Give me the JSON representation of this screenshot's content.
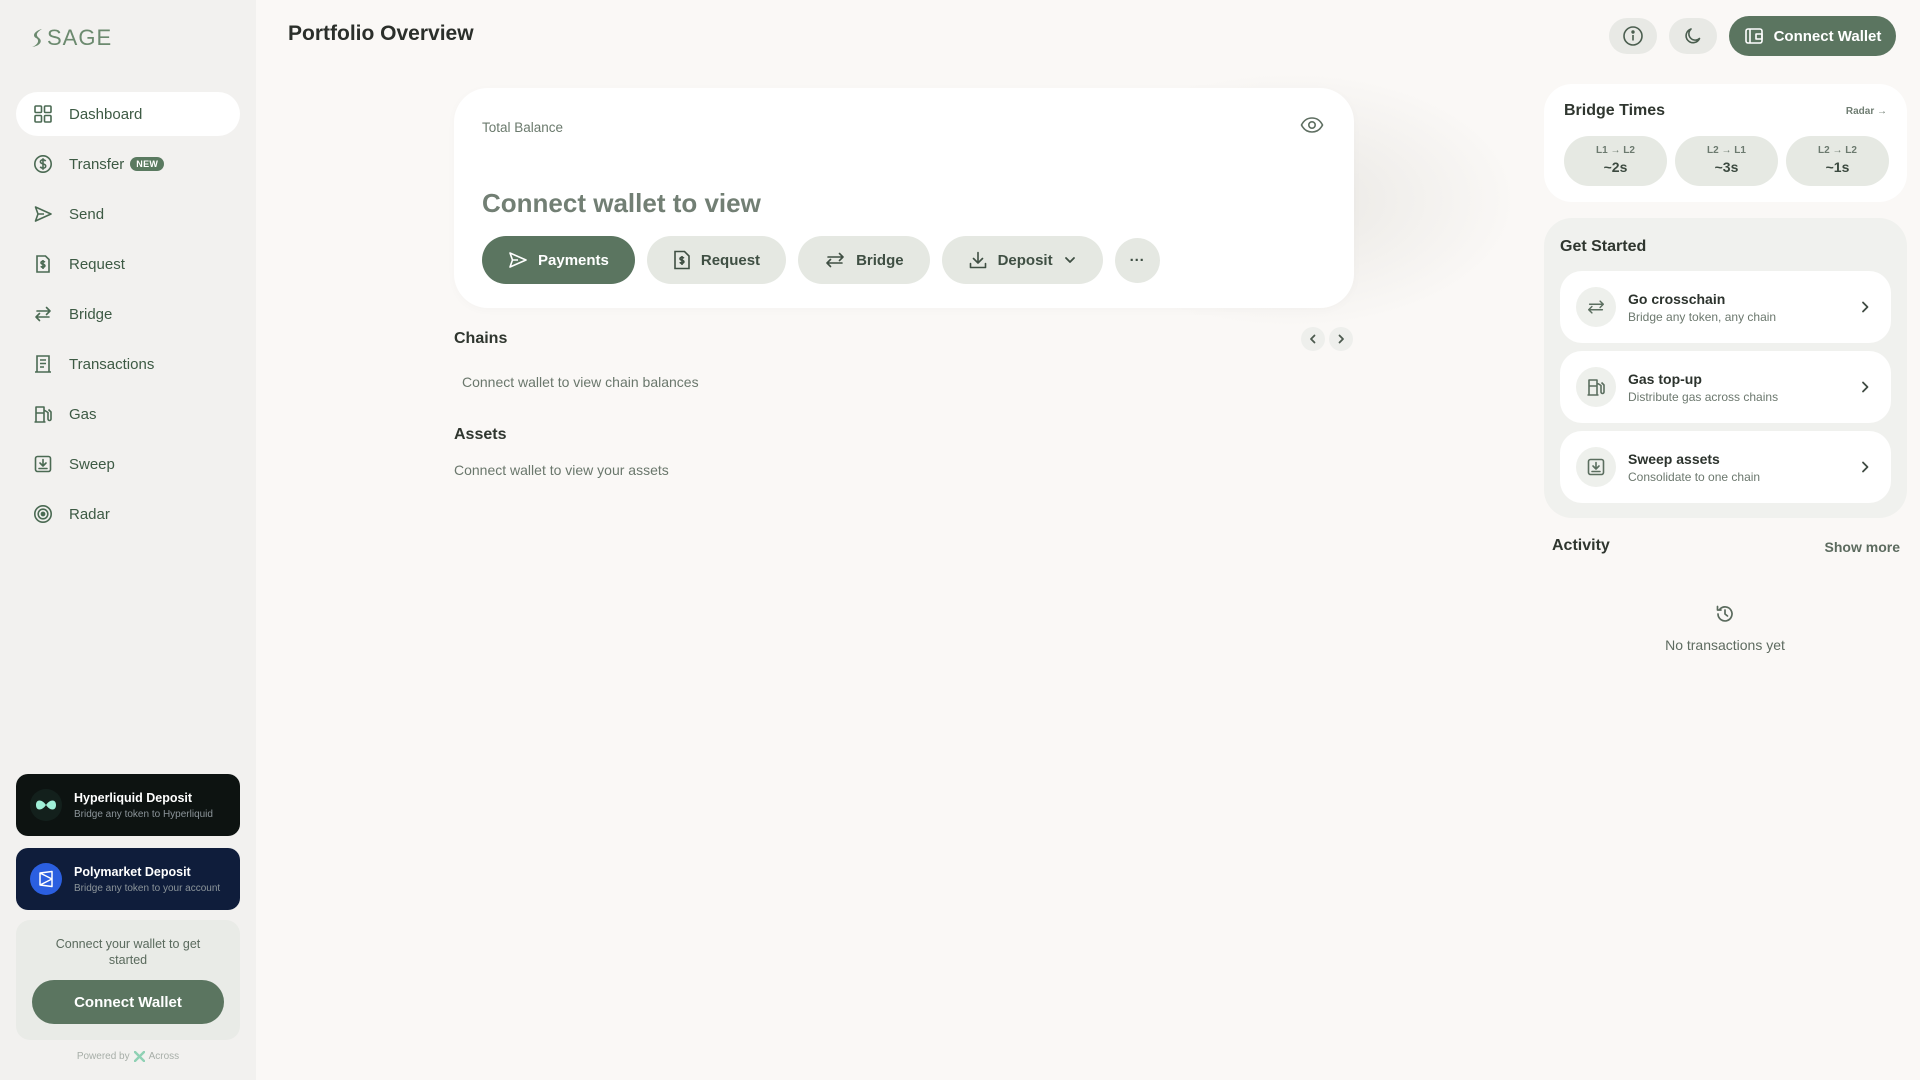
{
  "app": {
    "logo": "SAGE"
  },
  "sidebar": {
    "items": [
      {
        "label": "Dashboard",
        "icon": "grid-icon",
        "active": true
      },
      {
        "label": "Transfer",
        "icon": "dollar-circle-icon",
        "badge": "NEW"
      },
      {
        "label": "Send",
        "icon": "send-icon"
      },
      {
        "label": "Request",
        "icon": "receipt-icon"
      },
      {
        "label": "Bridge",
        "icon": "arrows-swap-icon"
      },
      {
        "label": "Transactions",
        "icon": "ledger-icon"
      },
      {
        "label": "Gas",
        "icon": "fuel-icon"
      },
      {
        "label": "Sweep",
        "icon": "sweep-icon"
      },
      {
        "label": "Radar",
        "icon": "radar-icon"
      }
    ],
    "promos": [
      {
        "title": "Hyperliquid Deposit",
        "subtitle": "Bridge any token to Hyperliquid"
      },
      {
        "title": "Polymarket Deposit",
        "subtitle": "Bridge any token to your account"
      }
    ],
    "connect_prompt": "Connect your wallet to get started",
    "connect_button": "Connect Wallet",
    "powered_by": "Powered by",
    "powered_brand": "Across"
  },
  "header": {
    "title": "Portfolio Overview",
    "connect_button": "Connect Wallet"
  },
  "balance": {
    "label": "Total Balance",
    "value": "Connect wallet to view",
    "actions": {
      "payments": "Payments",
      "request": "Request",
      "bridge": "Bridge",
      "deposit": "Deposit",
      "more": "···"
    }
  },
  "chains": {
    "title": "Chains",
    "empty": "Connect wallet to view chain balances"
  },
  "assets": {
    "title": "Assets",
    "empty": "Connect wallet to view your assets"
  },
  "bridge_times": {
    "title": "Bridge Times",
    "link": "Radar →",
    "routes": [
      {
        "route": "L1 → L2",
        "time": "~2s"
      },
      {
        "route": "L2 → L1",
        "time": "~3s"
      },
      {
        "route": "L2 → L2",
        "time": "~1s"
      }
    ]
  },
  "get_started": {
    "title": "Get Started",
    "items": [
      {
        "title": "Go crosschain",
        "subtitle": "Bridge any token, any chain"
      },
      {
        "title": "Gas top-up",
        "subtitle": "Distribute gas across chains"
      },
      {
        "title": "Sweep assets",
        "subtitle": "Consolidate to one chain"
      }
    ]
  },
  "activity": {
    "title": "Activity",
    "show_more": "Show more",
    "empty": "No transactions yet"
  },
  "colors": {
    "accent": "#5b7560",
    "background": "#faf8f6",
    "sidebar": "#f2f1ef",
    "hyperliquid": "#0d1311",
    "polymarket": "#0f1d3b"
  }
}
